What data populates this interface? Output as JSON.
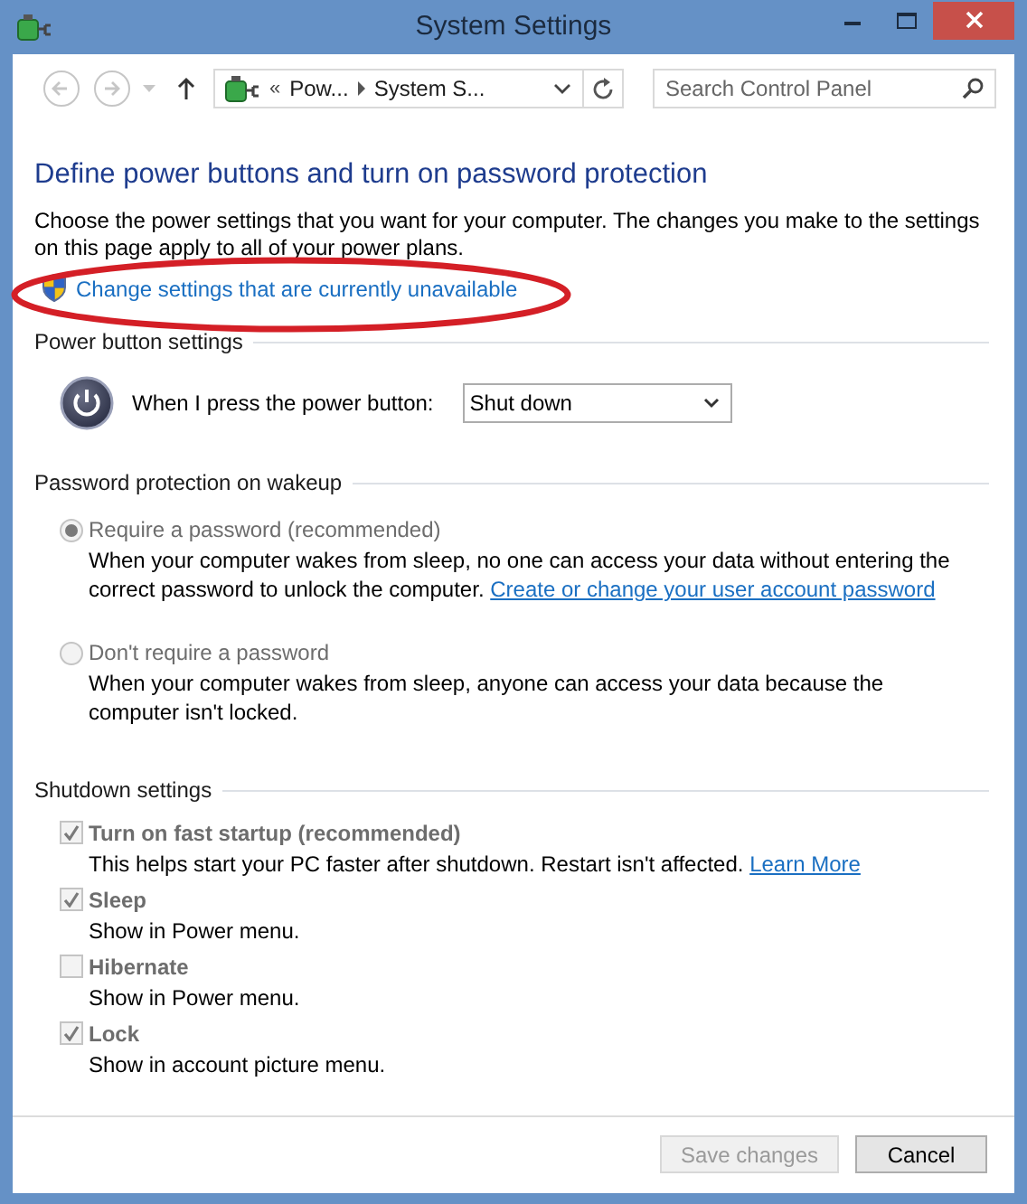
{
  "window": {
    "title": "System Settings"
  },
  "nav": {
    "back": {
      "disabled": true
    },
    "forward": {
      "disabled": true
    },
    "overflow": "«",
    "breadcrumbs": [
      "Pow...",
      "System S..."
    ],
    "search": {
      "placeholder": "Search Control Panel"
    }
  },
  "page": {
    "heading": "Define power buttons and turn on password protection",
    "description": "Choose the power settings that you want for your computer. The changes you make to the settings on this page apply to all of your power plans.",
    "admin_link": "Change settings that are currently unavailable"
  },
  "sections": [
    {
      "title": "Power button settings",
      "kind": "power",
      "label": "When I press the power button:",
      "value": "Shut down"
    },
    {
      "title": "Password protection on wakeup",
      "kind": "radios",
      "options": [
        {
          "label": "Require a password (recommended)",
          "selected": true,
          "disabled": true,
          "description": "When your computer wakes from sleep, no one can access your data without entering the correct password to unlock the computer.",
          "link": "Create or change your user account password"
        },
        {
          "label": "Don't require a password",
          "selected": false,
          "disabled": true,
          "description": "When your computer wakes from sleep, anyone can access your data because the computer isn't locked."
        }
      ]
    },
    {
      "title": "Shutdown settings",
      "kind": "checks",
      "options": [
        {
          "label": "Turn on fast startup (recommended)",
          "checked": true,
          "disabled": true,
          "description": "This helps start your PC faster after shutdown. Restart isn't affected.",
          "link": "Learn More"
        },
        {
          "label": "Sleep",
          "checked": true,
          "disabled": true,
          "description": "Show in Power menu."
        },
        {
          "label": "Hibernate",
          "checked": false,
          "disabled": true,
          "description": "Show in Power menu."
        },
        {
          "label": "Lock",
          "checked": true,
          "disabled": true,
          "description": "Show in account picture menu."
        }
      ]
    }
  ],
  "footer": {
    "buttons": [
      {
        "label": "Save changes",
        "disabled": true
      },
      {
        "label": "Cancel",
        "disabled": false
      }
    ]
  }
}
